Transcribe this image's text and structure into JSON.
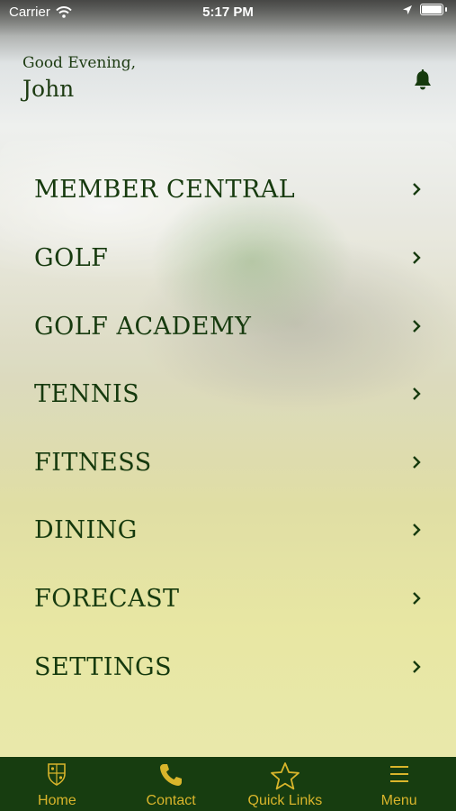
{
  "status_bar": {
    "carrier": "Carrier",
    "time": "5:17 PM"
  },
  "greeting": {
    "salutation": "Good Evening,",
    "name": "John"
  },
  "menu": {
    "items": [
      {
        "label": "MEMBER CENTRAL"
      },
      {
        "label": "GOLF"
      },
      {
        "label": "GOLF ACADEMY"
      },
      {
        "label": "TENNIS"
      },
      {
        "label": "FITNESS"
      },
      {
        "label": "DINING"
      },
      {
        "label": "FORECAST"
      },
      {
        "label": "SETTINGS"
      }
    ]
  },
  "tabs": [
    {
      "label": "Home",
      "icon": "crest-icon"
    },
    {
      "label": "Contact",
      "icon": "phone-icon"
    },
    {
      "label": "Quick Links",
      "icon": "star-icon"
    },
    {
      "label": "Menu",
      "icon": "hamburger-icon"
    }
  ],
  "colors": {
    "tab_bar": "#173d10",
    "tab_text": "#d9b52b",
    "menu_text": "#163a0e"
  }
}
